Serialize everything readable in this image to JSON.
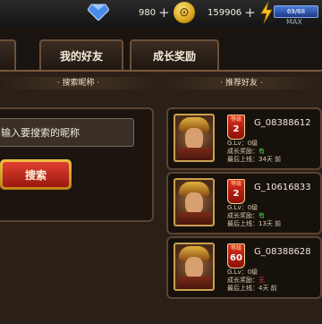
{
  "resources": {
    "gems": "980",
    "gold": "159906",
    "plus": "+",
    "energy_value": "69/68",
    "max_label": "MAX"
  },
  "tabs": [
    "",
    "我的好友",
    "成长奖励"
  ],
  "search": {
    "section_title": "· 搜索昵称 ·",
    "placeholder": "输入要搜索的昵称",
    "button_label": "搜索"
  },
  "recommend": {
    "section_title": "· 推荐好友 ·",
    "level_tag": "等级",
    "friends": [
      {
        "level": "2",
        "name": "G_08388612",
        "glv": "G.Lv：0级",
        "reward_label": "成长奖励：",
        "reward": "有",
        "has_reward": true,
        "last": "最后上线：34天 前"
      },
      {
        "level": "2",
        "name": "G_10616833",
        "glv": "G.Lv：0级",
        "reward_label": "成长奖励：",
        "reward": "有",
        "has_reward": true,
        "last": "最后上线：13天 前"
      },
      {
        "level": "60",
        "name": "G_08388628",
        "glv": "G.Lv：0级",
        "reward_label": "成长奖励：",
        "reward": "无",
        "has_reward": false,
        "last": "最后上线：4天 前"
      }
    ]
  },
  "colors": {
    "reward_yes": "#4ad44a",
    "reward_no": "#e03a2a",
    "accent_gold": "#c8a050"
  },
  "icons": [
    "diamond-icon",
    "gold-coin-icon",
    "lightning-icon"
  ]
}
